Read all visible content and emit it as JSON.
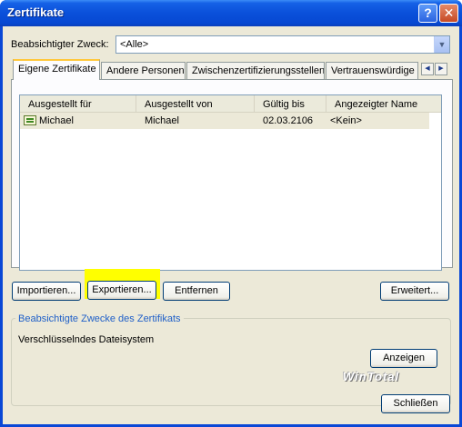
{
  "window": {
    "title": "Zertifikate",
    "help_glyph": "?",
    "close_glyph": "✕"
  },
  "purpose": {
    "label": "Beabsichtigter Zweck:",
    "value": "<Alle>"
  },
  "tabs": [
    {
      "label": "Eigene Zertifikate",
      "active": true
    },
    {
      "label": "Andere Personen"
    },
    {
      "label": "Zwischenzertifizierungsstellen"
    },
    {
      "label": "Vertrauenswürdige Stammzertifizierungsstellen"
    }
  ],
  "table": {
    "columns": [
      "Ausgestellt für",
      "Ausgestellt von",
      "Gültig bis",
      "Angezeigter Name"
    ],
    "rows": [
      [
        "Michael",
        "Michael",
        "02.03.2106",
        "<Kein>"
      ]
    ]
  },
  "buttons": {
    "import": "Importieren...",
    "export": "Exportieren...",
    "remove": "Entfernen",
    "advanced": "Erweitert...",
    "view": "Anzeigen",
    "close": "Schließen"
  },
  "group": {
    "title": "Beabsichtigte Zwecke des Zertifikats",
    "text": "Verschlüsselndes Dateisystem"
  },
  "watermark": "WinTotal",
  "colors": {
    "titlebar": "#0a50da",
    "dialog_bg": "#ece9d8",
    "highlight": "#ffff00",
    "group_title": "#2060c8"
  }
}
